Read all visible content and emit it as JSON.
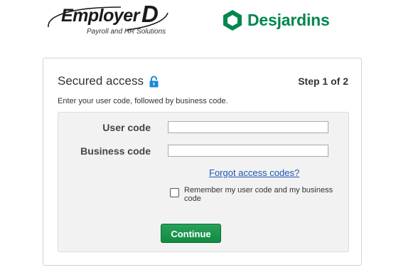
{
  "header": {
    "employer_logo": {
      "word": "Employer",
      "letter": "D",
      "tagline": "Payroll and HR Solutions"
    },
    "desjardins_logo": {
      "name": "Desjardins",
      "color": "#00874e"
    }
  },
  "card": {
    "title": "Secured access",
    "step": "Step 1 of 2",
    "instructions": "Enter your user code, followed by business code.",
    "lock_icon": "lock-icon"
  },
  "form": {
    "user_code_label": "User code",
    "user_code_value": "",
    "business_code_label": "Business code",
    "business_code_value": "",
    "forgot_link": "Forgot access codes?",
    "remember_label": "Remember my user code and my business code",
    "remember_checked": false,
    "continue_label": "Continue",
    "accent_color": "#108a41"
  }
}
